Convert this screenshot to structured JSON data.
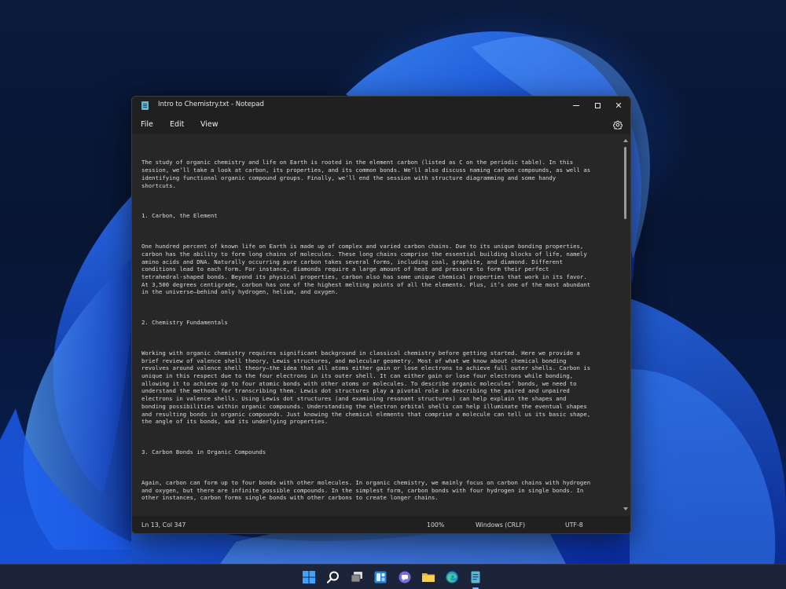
{
  "window": {
    "title": "Intro to Chemistry.txt - Notepad",
    "minimize_icon": "minimize-icon",
    "maximize_icon": "maximize-icon",
    "close_icon": "close-icon",
    "close_glyph": "✕"
  },
  "menu": {
    "file": "File",
    "edit": "Edit",
    "view": "View",
    "settings_icon": "gear-icon"
  },
  "editor": {
    "paragraphs": [
      "The study of organic chemistry and life on Earth is rooted in the element carbon (listed as C on the periodic table). In this\nsession, we’ll take a look at carbon, its properties, and its common bonds. We’ll also discuss naming carbon compounds, as well as\nidentifying functional organic compound groups. Finally, we’ll end the session with structure diagramming and some handy\nshortcuts.",
      "1. Carbon, the Element",
      "One hundred percent of known life on Earth is made up of complex and varied carbon chains. Due to its unique bonding properties,\ncarbon has the ability to form long chains of molecules. These long chains comprise the essential building blocks of life, namely\namino acids and DNA. Naturally occurring pure carbon takes several forms, including coal, graphite, and diamond. Different\nconditions lead to each form. For instance, diamonds require a large amount of heat and pressure to form their perfect\ntetrahedral-shaped bonds. Beyond its physical properties, carbon also has some unique chemical properties that work in its favor.\nAt 3,500 degrees centigrade, carbon has one of the highest melting points of all the elements. Plus, it’s one of the most abundant\nin the universe—behind only hydrogen, helium, and oxygen.",
      "2. Chemistry Fundamentals",
      "Working with organic chemistry requires significant background in classical chemistry before getting started. Here we provide a\nbrief review of valence shell theory, Lewis structures, and molecular geometry. Most of what we know about chemical bonding\nrevolves around valence shell theory—the idea that all atoms either gain or lose electrons to achieve full outer shells. Carbon is\nunique in this respect due to the four electrons in its outer shell. It can either gain or lose four electrons while bonding,\nallowing it to achieve up to four atomic bonds with other atoms or molecules. To describe organic molecules’ bonds, we need to\nunderstand the methods for transcribing them. Lewis dot structures play a pivotal role in describing the paired and unpaired\nelectrons in valence shells. Using Lewis dot structures (and examining resonant structures) can help explain the shapes and\nbonding possibilities within organic compounds. Understanding the electron orbital shells can help illuminate the eventual shapes\nand resulting bonds in organic compounds. Just knowing the chemical elements that comprise a molecule can tell us its basic shape,\nthe angle of its bonds, and its underlying properties.",
      "3. Carbon Bonds in Organic Compounds",
      "Again, carbon can form up to four bonds with other molecules. In organic chemistry, we mainly focus on carbon chains with hydrogen\nand oxygen, but there are infinite possible compounds. In the simplest form, carbon bonds with four hydrogen in single bonds. In\nother instances, carbon forms single bonds with other carbons to create longer chains."
    ]
  },
  "status": {
    "position": "Ln 13, Col 347",
    "zoom": "100%",
    "line_ending": "Windows (CRLF)",
    "encoding": "UTF-8"
  },
  "taskbar": {
    "icons": [
      "windows-start-icon",
      "search-icon",
      "task-view-icon",
      "widgets-icon",
      "teams-chat-icon",
      "file-explorer-icon",
      "edge-browser-icon",
      "notepad-icon"
    ]
  },
  "colors": {
    "window_bg": "#272727",
    "titlebar_bg": "#202020",
    "text": "#dcdcdc",
    "accent": "#2f7bff"
  }
}
